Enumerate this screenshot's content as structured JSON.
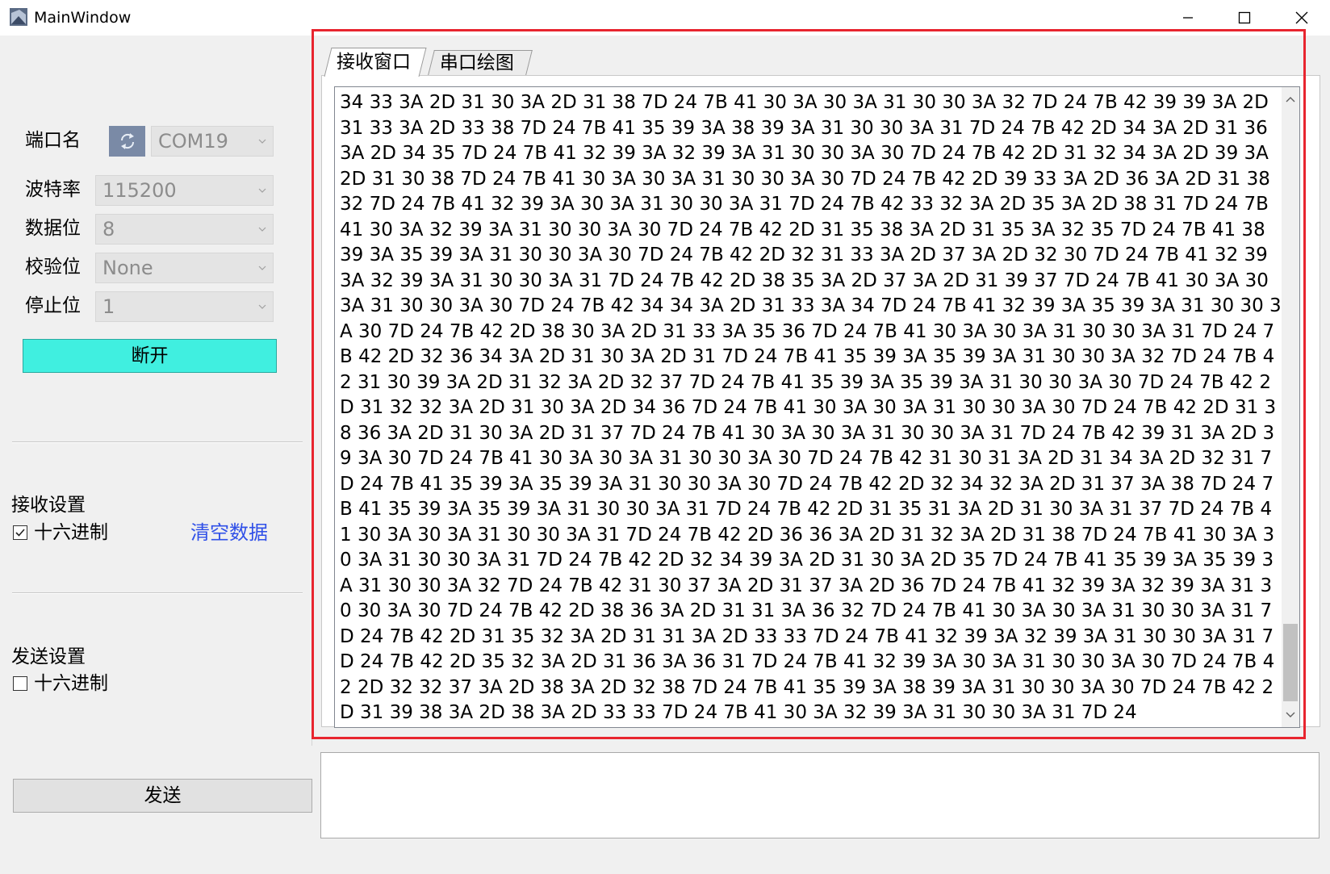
{
  "window": {
    "title": "MainWindow"
  },
  "serial_settings": {
    "port_label": "端口名",
    "port_value": "COM19",
    "baud_label": "波特率",
    "baud_value": "115200",
    "data_bits_label": "数据位",
    "data_bits_value": "8",
    "parity_label": "校验位",
    "parity_value": "None",
    "stop_bits_label": "停止位",
    "stop_bits_value": "1",
    "disconnect_label": "断开"
  },
  "receive_settings": {
    "heading": "接收设置",
    "hex_label": "十六进制",
    "hex_checked": true,
    "clear_label": "清空数据"
  },
  "send_settings": {
    "heading": "发送设置",
    "hex_label": "十六进制",
    "hex_checked": false,
    "send_label": "发送",
    "send_text": ""
  },
  "tabs": [
    {
      "label": "接收窗口",
      "active": true
    },
    {
      "label": "串口绘图",
      "active": false
    }
  ],
  "receive_text": "34 33 3A 2D 31 30 3A 2D 31 38 7D 24 7B 41 30 3A 30 3A 31 30 30 3A 32 7D 24 7B 42 39 39 3A 2D 31 33 3A 2D 33 38 7D 24 7B 41 35 39 3A 38 39 3A 31 30 30 3A 31 7D 24 7B 42 2D 34 3A 2D 31 36 3A 2D 34 35 7D 24 7B 41 32 39 3A 32 39 3A 31 30 30 3A 30 7D 24 7B 42 2D 31 32 34 3A 2D 39 3A 2D 31 30 38 7D 24 7B 41 30 3A 30 3A 31 30 30 3A 30 7D 24 7B 42 2D 39 33 3A 2D 36 3A 2D 31 38 32 7D 24 7B 41 32 39 3A 30 3A 31 30 30 3A 31 7D 24 7B 42 33 32 3A 2D 35 3A 2D 38 31 7D 24 7B 41 30 3A 32 39 3A 31 30 30 3A 30 7D 24 7B 42 2D 31 35 38 3A 2D 31 35 3A 32 35 7D 24 7B 41 38 39 3A 35 39 3A 31 30 30 3A 30 7D 24 7B 42 2D 32 31 33 3A 2D 37 3A 2D 32 30 7D 24 7B 41 32 39 3A 32 39 3A 31 30 30 3A 31 7D 24 7B 42 2D 38 35 3A 2D 37 3A 2D 31 39 37 7D 24 7B 41 30 3A 30 3A 31 30 30 3A 30 7D 24 7B 42 34 34 3A 2D 31 33 3A 34 7D 24 7B 41 32 39 3A 35 39 3A 31 30 30 3A 30 7D 24 7B 42 2D 38 30 3A 2D 31 33 3A 35 36 7D 24 7B 41 30 3A 30 3A 31 30 30 3A 31 7D 24 7B 42 2D 32 36 34 3A 2D 31 30 3A 2D 31 7D 24 7B 41 35 39 3A 35 39 3A 31 30 30 3A 32 7D 24 7B 42 31 30 39 3A 2D 31 32 3A 2D 32 37 7D 24 7B 41 35 39 3A 35 39 3A 31 30 30 3A 30 7D 24 7B 42 2D 31 32 32 3A 2D 31 30 3A 2D 34 36 7D 24 7B 41 30 3A 30 3A 31 30 30 3A 30 7D 24 7B 42 2D 31 38 36 3A 2D 31 30 3A 2D 31 37 7D 24 7B 41 30 3A 30 3A 31 30 30 3A 31 7D 24 7B 42 39 31 3A 2D 39 3A 30 7D 24 7B 41 30 3A 30 3A 31 30 30 3A 30 7D 24 7B 42 31 30 31 3A 2D 31 34 3A 2D 32 31 7D 24 7B 41 35 39 3A 35 39 3A 31 30 30 3A 30 7D 24 7B 42 2D 32 34 32 3A 2D 31 37 3A 38 7D 24 7B 41 35 39 3A 35 39 3A 31 30 30 3A 31 7D 24 7B 42 2D 31 35 31 3A 2D 31 30 3A 31 37 7D 24 7B 41 30 3A 30 3A 31 30 30 3A 31 7D 24 7B 42 2D 36 36 3A 2D 31 32 3A 2D 31 38 7D 24 7B 41 30 3A 30 3A 31 30 30 3A 31 7D 24 7B 42 2D 32 34 39 3A 2D 31 30 3A 2D 35 7D 24 7B 41 35 39 3A 35 39 3A 31 30 30 3A 32 7D 24 7B 42 31 30 37 3A 2D 31 37 3A 2D 36 7D 24 7B 41 32 39 3A 32 39 3A 31 30 30 3A 30 7D 24 7B 42 2D 38 36 3A 2D 31 31 3A 36 32 7D 24 7B 41 30 3A 30 3A 31 30 30 3A 31 7D 24 7B 42 2D 31 35 32 3A 2D 31 31 3A 2D 33 33 7D 24 7B 41 32 39 3A 32 39 3A 31 30 30 3A 31 7D 24 7B 42 2D 35 32 3A 2D 31 36 3A 36 31 7D 24 7B 41 32 39 3A 30 3A 31 30 30 3A 30 7D 24 7B 42 2D 32 32 37 3A 2D 38 3A 2D 32 38 7D 24 7B 41 35 39 3A 38 39 3A 31 30 30 3A 30 7D 24 7B 42 2D 31 39 38 3A 2D 38 3A 2D 33 33 7D 24 7B 41 30 3A 32 39 3A 31 30 30 3A 31 7D 24"
}
